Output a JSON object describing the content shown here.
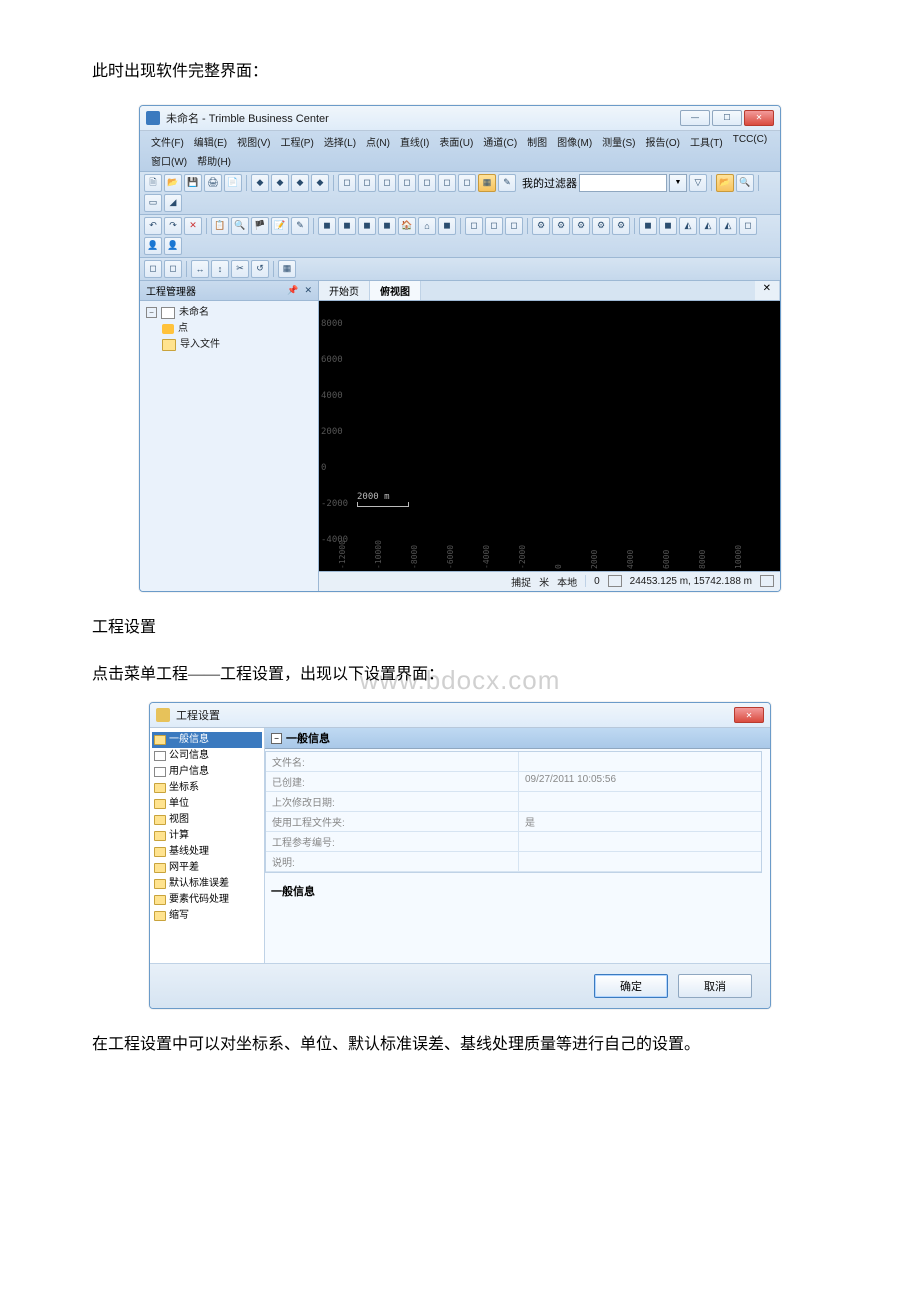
{
  "text": {
    "line1": "此时出现软件完整界面：",
    "line2": "工程设置",
    "line3": "点击菜单工程——工程设置，出现以下设置界面：",
    "line4": "在工程设置中可以对坐标系、单位、默认标准误差、基线处理质量等进行自己的设置。",
    "watermark": "www.bdocx.com"
  },
  "win1": {
    "title": "未命名 - Trimble Business Center",
    "menu": [
      "文件(F)",
      "编辑(E)",
      "视图(V)",
      "工程(P)",
      "选择(L)",
      "点(N)",
      "直线(I)",
      "表面(U)",
      "通道(C)",
      "制图",
      "图像(M)",
      "测量(S)",
      "报告(O)",
      "工具(T)",
      "TCC(C)",
      "窗口(W)",
      "帮助(H)"
    ],
    "filter_label": "我的过滤器",
    "panel_title": "工程管理器",
    "tree": {
      "root": "未命名",
      "child1": "点",
      "child2": "导入文件"
    },
    "tabs": {
      "start": "开始页",
      "plan": "俯视图"
    },
    "y_ticks": [
      "8000",
      "6000",
      "4000",
      "2000",
      "0",
      "-2000",
      "-4000"
    ],
    "x_ticks": [
      "-12000",
      "-10000",
      "-8000",
      "-6000",
      "-4000",
      "-2000",
      "0",
      "2000",
      "4000",
      "6000",
      "8000",
      "10000"
    ],
    "scale_label": "2000 m",
    "status": {
      "snap": "捕捉",
      "unit": "米",
      "local": "本地",
      "zero": "0",
      "coords": "24453.125 m, 15742.188 m"
    }
  },
  "win2": {
    "title": "工程设置",
    "tree": [
      {
        "label": "一般信息",
        "t": "folder",
        "sel": true
      },
      {
        "label": "公司信息",
        "t": "leaf"
      },
      {
        "label": "用户信息",
        "t": "leaf"
      },
      {
        "label": "坐标系",
        "t": "folder"
      },
      {
        "label": "单位",
        "t": "folder"
      },
      {
        "label": "视图",
        "t": "folder"
      },
      {
        "label": "计算",
        "t": "folder"
      },
      {
        "label": "基线处理",
        "t": "folder"
      },
      {
        "label": "网平差",
        "t": "folder"
      },
      {
        "label": "默认标准误差",
        "t": "folder"
      },
      {
        "label": "要素代码处理",
        "t": "folder"
      },
      {
        "label": "缩写",
        "t": "folder"
      }
    ],
    "form_head": "一般信息",
    "rows": [
      {
        "l": "文件名:",
        "r": ""
      },
      {
        "l": "已创建:",
        "r": "09/27/2011 10:05:56"
      },
      {
        "l": "上次修改日期:",
        "r": ""
      },
      {
        "l": "使用工程文件夹:",
        "r": "是"
      },
      {
        "l": "工程参考编号:",
        "r": ""
      },
      {
        "l": "说明:",
        "r": ""
      }
    ],
    "section2": "一般信息",
    "ok": "确定",
    "cancel": "取消"
  }
}
